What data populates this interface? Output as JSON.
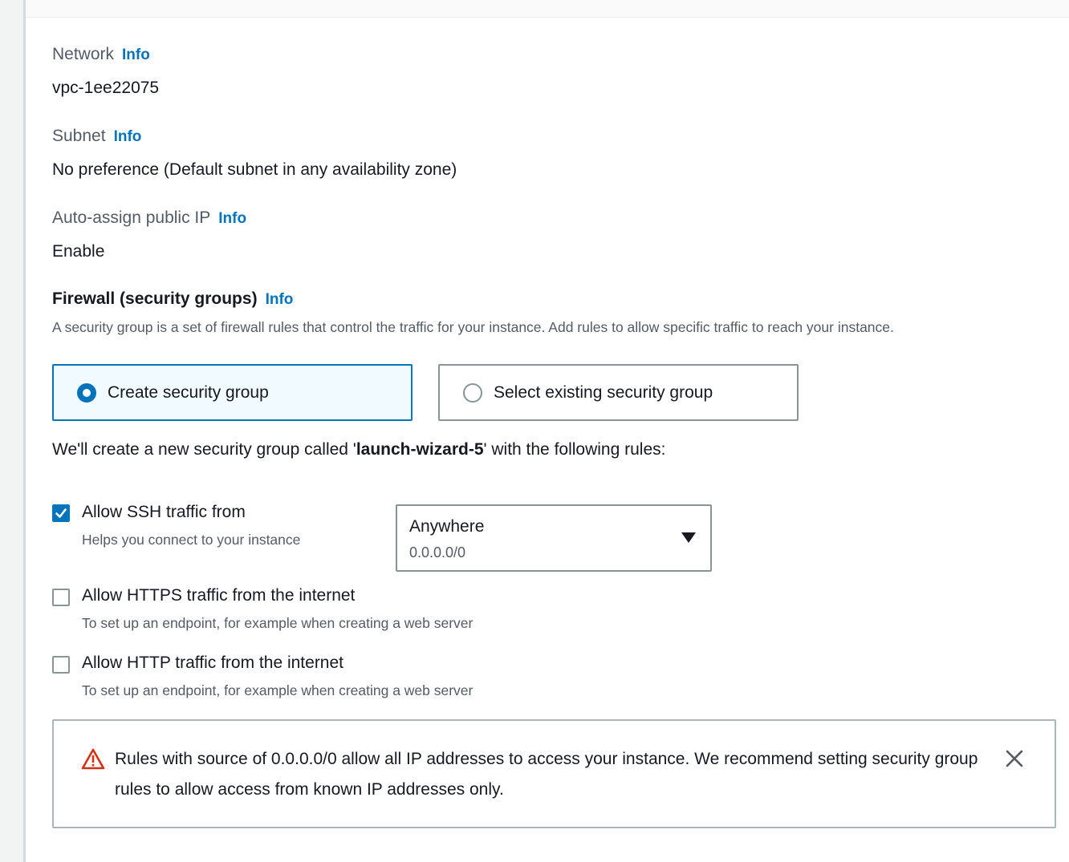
{
  "network": {
    "label": "Network",
    "info": "Info",
    "value": "vpc-1ee22075"
  },
  "subnet": {
    "label": "Subnet",
    "info": "Info",
    "value": "No preference (Default subnet in any availability zone)"
  },
  "public_ip": {
    "label": "Auto-assign public IP",
    "info": "Info",
    "value": "Enable"
  },
  "firewall": {
    "title": "Firewall (security groups)",
    "info": "Info",
    "description": "A security group is a set of firewall rules that control the traffic for your instance. Add rules to allow specific traffic to reach your instance.",
    "options": [
      {
        "label": "Create security group",
        "selected": true
      },
      {
        "label": "Select existing security group",
        "selected": false
      }
    ],
    "note_prefix": "We'll create a new security group called '",
    "group_name": "launch-wizard-5",
    "note_suffix": "' with the following rules:"
  },
  "rules": [
    {
      "label": "Allow SSH traffic from",
      "description": "Helps you connect to your instance",
      "checked": true
    },
    {
      "label": "Allow HTTPS traffic from the internet",
      "description": "To set up an endpoint, for example when creating a web server",
      "checked": false
    },
    {
      "label": "Allow HTTP traffic from the internet",
      "description": "To set up an endpoint, for example when creating a web server",
      "checked": false
    }
  ],
  "ssh_source": {
    "selected": "Anywhere",
    "detail": "0.0.0.0/0"
  },
  "alert": {
    "message": "Rules with source of 0.0.0.0/0 allow all IP addresses to access your instance. We recommend setting security group rules to allow access from known IP addresses only."
  },
  "colors": {
    "accent": "#0073bb",
    "warning": "#d13212",
    "border": "#879596"
  },
  "icons": {
    "warning": "warning-triangle-icon",
    "close": "close-icon",
    "caret": "caret-down-icon",
    "check": "checkmark-icon"
  }
}
